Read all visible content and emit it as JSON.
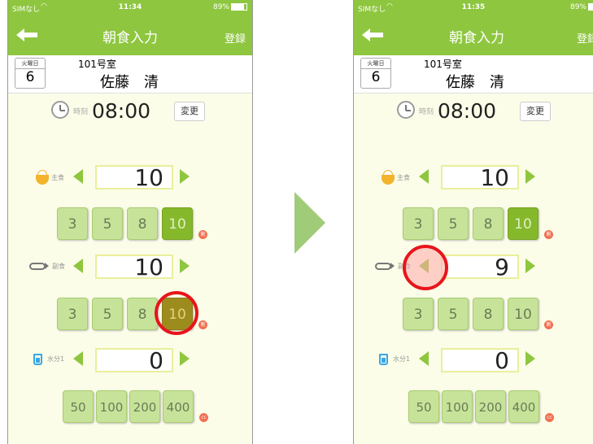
{
  "app": {
    "carrier": "SIMなし",
    "battery": "89%",
    "title": "朝食入力",
    "register_label": "登録",
    "day_of_week": "火曜日",
    "day": "6",
    "room": "101号室",
    "resident_name": "佐藤　清",
    "time_label": "時刻",
    "time_value": "08:00",
    "change_label": "変更",
    "staple_label": "主食",
    "side_label": "副食",
    "water_label": "水分1",
    "unit_portion": "割",
    "unit_cc": "cc",
    "portion_buttons": [
      "3",
      "5",
      "8",
      "10"
    ],
    "water_buttons": [
      "50",
      "100",
      "200",
      "400"
    ]
  },
  "before": {
    "clock": "11:34",
    "staple_value": "10",
    "side_value": "10",
    "water_value": "0"
  },
  "after": {
    "clock": "11:35",
    "staple_value": "10",
    "side_value": "9",
    "water_value": "0"
  },
  "colors": {
    "accent": "#8ec63f",
    "background": "#fbfde8",
    "button": "#c7e39a",
    "button_selected": "#86b82c",
    "highlight_ring": "#e8141b",
    "transition_arrow": "#a0cc7a"
  },
  "icons": [
    "back-arrow-icon",
    "clock-icon",
    "rice-bowl-icon",
    "fish-icon",
    "water-cup-icon",
    "wifi-icon",
    "battery-icon"
  ]
}
